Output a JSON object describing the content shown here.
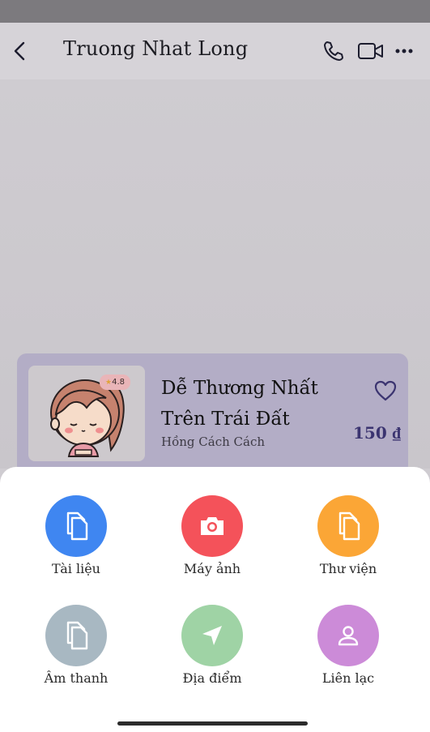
{
  "header": {
    "title": "Truong Nhat Long"
  },
  "icons": {
    "back": "chevron-left-icon",
    "call": "phone-icon",
    "video": "video-camera-icon",
    "more": "more-horizontal-icon",
    "favorite": "heart-icon"
  },
  "product": {
    "rating": "4.8",
    "name": "Dễ Thương Nhất Trên Trái Đất",
    "shop": "Hồng Cách Cách",
    "price": "150 ₫"
  },
  "attach_options": [
    {
      "label": "Tài liệu",
      "icon": "document-icon",
      "color": "#3f86f1"
    },
    {
      "label": "Máy ảnh",
      "icon": "camera-icon",
      "color": "#f4525a"
    },
    {
      "label": "Thư viện",
      "icon": "gallery-icon",
      "color": "#fba636"
    },
    {
      "label": "Âm thanh",
      "icon": "audio-file-icon",
      "color": "#a8b8c2"
    },
    {
      "label": "Địa điểm",
      "icon": "location-icon",
      "color": "#9fd3a5"
    },
    {
      "label": "Liên lạc",
      "icon": "contact-icon",
      "color": "#cc8bd8"
    }
  ]
}
